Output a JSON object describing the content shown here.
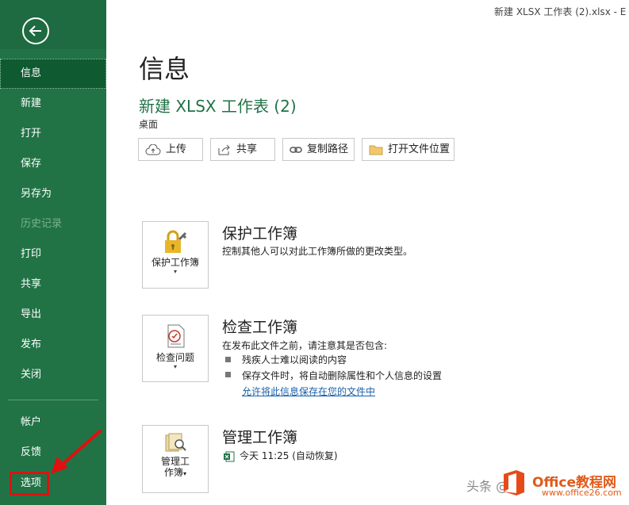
{
  "window": {
    "title": "新建 XLSX 工作表 (2).xlsx  -  E"
  },
  "sidebar": {
    "items": [
      {
        "label": "信息"
      },
      {
        "label": "新建"
      },
      {
        "label": "打开"
      },
      {
        "label": "保存"
      },
      {
        "label": "另存为"
      },
      {
        "label": "历史记录"
      },
      {
        "label": "打印"
      },
      {
        "label": "共享"
      },
      {
        "label": "导出"
      },
      {
        "label": "发布"
      },
      {
        "label": "关闭"
      },
      {
        "label": "帐户"
      },
      {
        "label": "反馈"
      },
      {
        "label": "选项"
      }
    ],
    "active": "信息",
    "disabled": "历史记录",
    "highlighted": "选项",
    "color": "#217346",
    "highlight_color": "#e01010"
  },
  "main": {
    "title": "信息",
    "document_name": "新建 XLSX 工作表 (2)",
    "location": "桌面",
    "actions": [
      {
        "label": "上传",
        "icon": "upload-cloud-icon"
      },
      {
        "label": "共享",
        "icon": "share-icon"
      },
      {
        "label": "复制路径",
        "icon": "link-icon"
      },
      {
        "label": "打开文件位置",
        "icon": "folder-icon"
      }
    ],
    "sections": {
      "protect": {
        "button_label": "保护工作簿",
        "title": "保护工作簿",
        "description": "控制其他人可以对此工作簿所做的更改类型。"
      },
      "inspect": {
        "button_label": "检查问题",
        "title": "检查工作簿",
        "description": "在发布此文件之前，请注意其是否包含:",
        "bullets": [
          "残疾人士难以阅读的内容",
          "保存文件时，将自动删除属性和个人信息的设置"
        ],
        "link": "允许将此信息保存在您的文件中"
      },
      "manage": {
        "button_label_1": "管理工",
        "button_label_2": "作簿",
        "title": "管理工作簿",
        "version": "今天 11:25 (自动恢复)"
      }
    }
  },
  "watermark": {
    "text": "头条 @",
    "brand": "Office教程网",
    "url": "www.office26.com"
  }
}
